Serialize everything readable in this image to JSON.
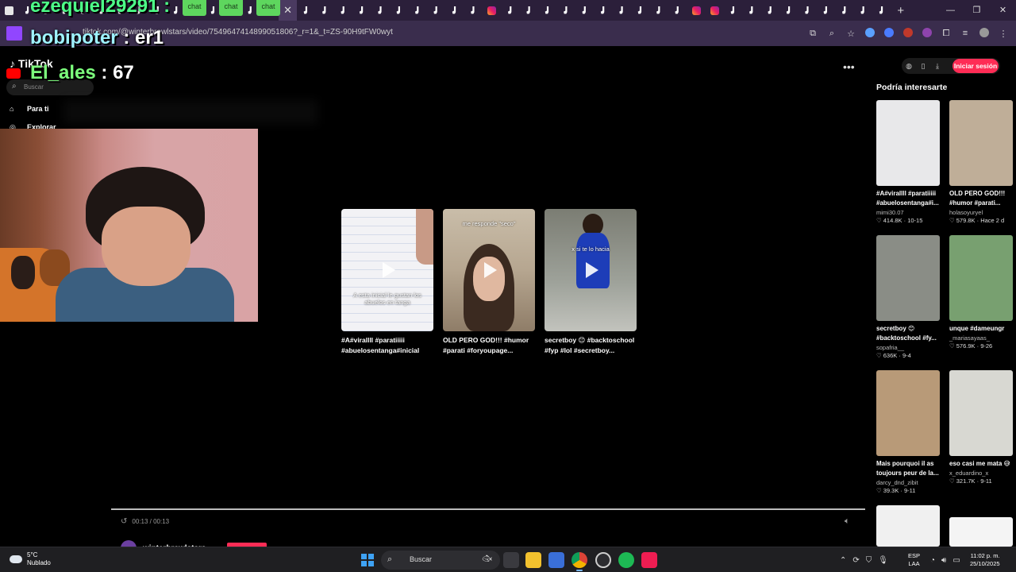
{
  "browser": {
    "tabs": [
      "twitch",
      "tiktok",
      "tiktok",
      "tiktok",
      "tiktok",
      "tiktok",
      "tiktok",
      "tiktok",
      "tiktok",
      "tiktok",
      "tiktok",
      "tiktok",
      "instagram",
      "tiktok",
      "tiktok",
      "close",
      "tiktok",
      "tiktok",
      "tiktok",
      "tiktok",
      "tiktok",
      "tiktok",
      "tiktok",
      "tiktok",
      "tiktok",
      "tiktok",
      "instagram",
      "tiktok",
      "tiktok",
      "tiktok",
      "tiktok",
      "tiktok",
      "tiktok",
      "tiktok",
      "tiktok",
      "tiktok",
      "tiktok",
      "instagram",
      "instagram",
      "tiktok",
      "tiktok",
      "tiktok",
      "tiktok",
      "tiktok",
      "tiktok",
      "tiktok",
      "tiktok",
      "tiktok"
    ],
    "new_tab_icon": "plus-icon",
    "url": "tiktok.com/@winterbrawlstars/video/7549647414899051806?_r=1&_t=ZS-90H9tFW0wyt",
    "window_controls": [
      "—",
      "❐",
      "✕"
    ]
  },
  "overlay": {
    "line1_user": "ezequiel29291 :",
    "chat_pills": [
      "chat",
      "chat",
      "chat"
    ],
    "line2_user": "bobipoter",
    "line2_msg": " : er1",
    "line3_user": "El_ales",
    "line3_msg": " : 67"
  },
  "tiktok": {
    "logo": "TikTok",
    "search_placeholder": "Buscar",
    "nav": [
      {
        "label": "Para ti",
        "icon": "home-icon"
      },
      {
        "label": "Explorar",
        "icon": "compass-icon"
      }
    ],
    "login_label": "Iniciar sesión",
    "more_label": "•••",
    "videos": [
      {
        "overlay_text": "A esta inicial le gustan los abuelos en tanga",
        "desc": "#A#virallll #paratiiiii #abuelosentanga#inicial",
        "style": "paper"
      },
      {
        "top_text": "me responde \"seco\"",
        "desc": "OLD PERO GOD!!! #humor #parati #foryoupage...",
        "style": "girl"
      },
      {
        "top_text": "x si te lo hacia",
        "desc": "secretboy 😊 #backtoschool #fyp #lol #secretboy...",
        "style": "class"
      }
    ],
    "suggestions_title": "Podría interesarte",
    "suggestions": [
      {
        "desc1": "#A#virallll #paratiiiii",
        "desc2": "#abuelosentanga#i...",
        "author": "mimi30.07",
        "likes": "414.8K",
        "date": "10-15",
        "color": "#e8e8ea"
      },
      {
        "desc1": "OLD PERO GOD!!!",
        "desc2": "#humor #parati...",
        "author": "holasoyuryel",
        "likes": "579.8K",
        "date": "Hace 2 d",
        "color": "#bfae98"
      },
      {
        "desc1": "secretboy 😊",
        "desc2": "#backtoschool #fy...",
        "author": "sopafria__",
        "likes": "636K",
        "date": "9-4",
        "color": "#8a8d86"
      },
      {
        "desc1": "unque #dameungr",
        "desc2": "",
        "author": "_mariasayaas_",
        "likes": "576.9K",
        "date": "9-26",
        "color": "#78a070"
      },
      {
        "desc1": "Mais pourquoi il as",
        "desc2": "toujours peur de la...",
        "author": "darcy_dnd_zibit",
        "likes": "39.3K",
        "date": "9-11",
        "color": "#b89a78"
      },
      {
        "desc1": "eso casi me mata 😅",
        "desc2": "",
        "author": "x_eduardino_x",
        "likes": "321.7K",
        "date": "9-11",
        "color": "#d8d8d2"
      },
      {
        "desc1": "",
        "desc2": "",
        "author": "",
        "likes": "",
        "date": "",
        "color": "#f0f0f0"
      },
      {
        "desc1": "",
        "desc2": "",
        "author": "",
        "likes": "",
        "date": "",
        "color": "#f4f4f4"
      }
    ],
    "player": {
      "time": "00:13 / 00:13",
      "progress": 1.0,
      "author": "winterbrawlstars"
    }
  },
  "taskbar": {
    "weather_temp": "5°C",
    "weather_desc": "Nublado",
    "search_placeholder": "Buscar",
    "lang1": "ESP",
    "lang2": "LAA",
    "time": "11:02 p. m.",
    "date": "25/10/2025"
  }
}
